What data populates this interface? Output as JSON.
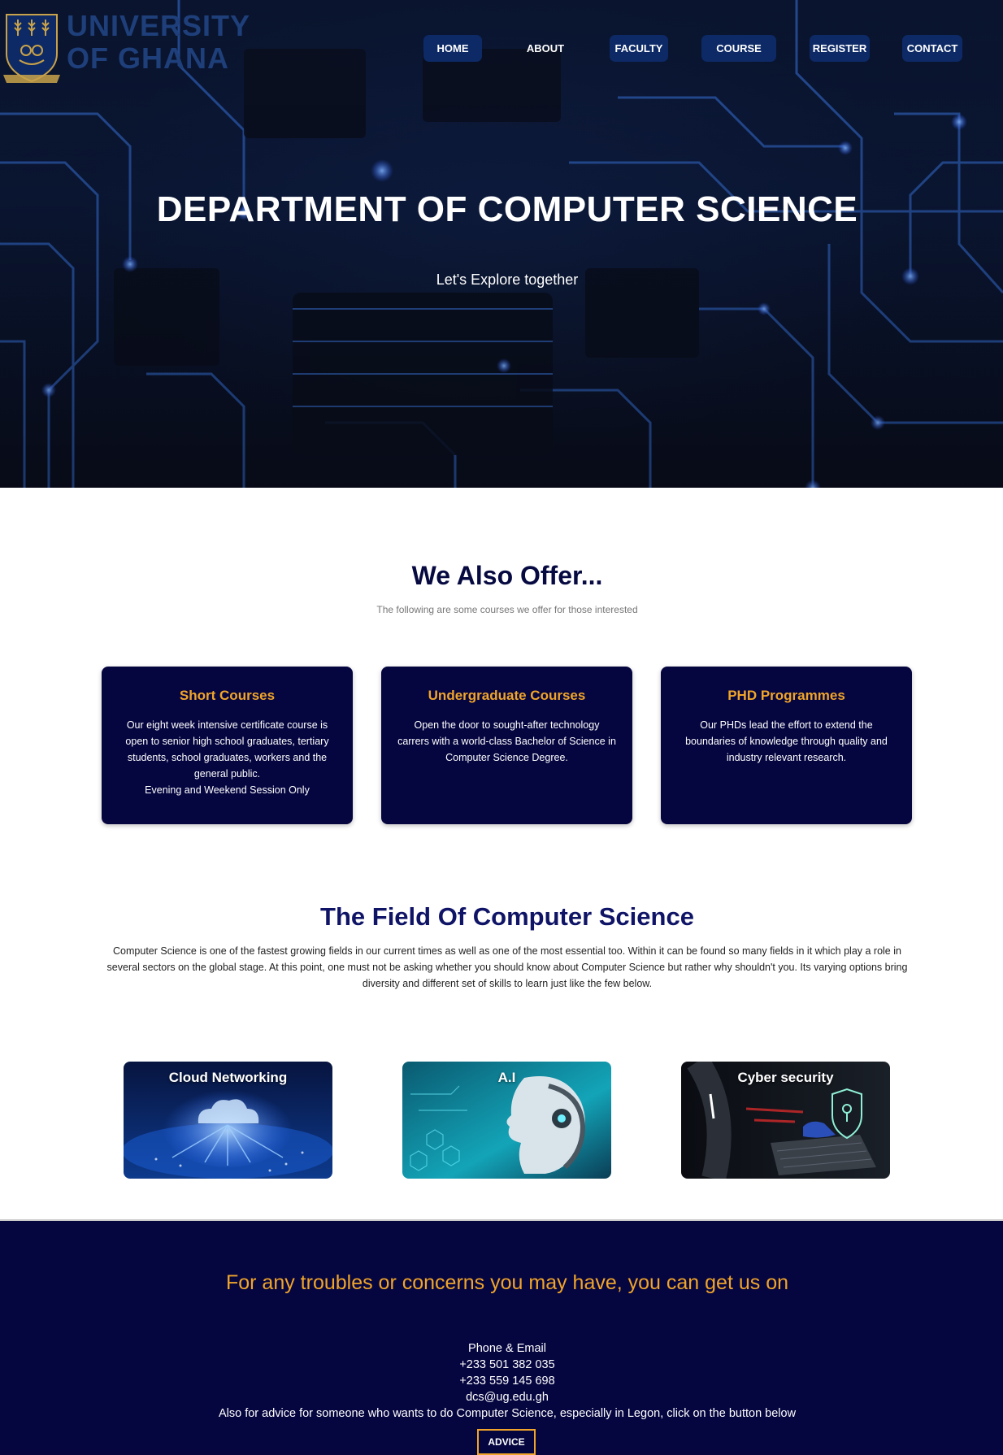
{
  "header": {
    "logo_text_line1": "UNIVERSITY",
    "logo_text_line2": "OF GHANA",
    "nav": [
      {
        "label": "HOME"
      },
      {
        "label": "ABOUT"
      },
      {
        "label": "FACULTY"
      },
      {
        "label": "COURSE"
      },
      {
        "label": "REGISTER"
      },
      {
        "label": "CONTACT"
      }
    ]
  },
  "hero": {
    "title": "DEPARTMENT OF COMPUTER SCIENCE",
    "subtitle": "Let's Explore together"
  },
  "offer": {
    "title": "We Also Offer...",
    "subtitle": "The following are some courses we offer for those interested",
    "cards": [
      {
        "title": "Short Courses",
        "text": "Our eight week intensive certificate course is open to senior high school graduates, tertiary students, school graduates, workers and the general public.",
        "note": "Evening and Weekend Session Only"
      },
      {
        "title": "Undergraduate Courses",
        "text": "Open the door to sought-after technology carrers with a world-class Bachelor of Science in Computer Science Degree."
      },
      {
        "title": "PHD Programmes",
        "text": "Our PHDs lead the effort to extend the boundaries of knowledge through quality and industry relevant research."
      }
    ]
  },
  "field": {
    "title": "The Field Of Computer Science",
    "text": "Computer Science is one of the fastest growing fields in our current times as well as one of the most essential too. Within it can be found so many fields in it which play a role in several sectors on the global stage. At this point, one must not be asking whether you should know about Computer Science but rather why shouldn't you. Its varying options bring diversity and different set of skills to learn just like the few below.",
    "tiles": [
      {
        "label": "Cloud Networking"
      },
      {
        "label": "A.I"
      },
      {
        "label": "Cyber security"
      }
    ]
  },
  "footer": {
    "title": "For any troubles or concerns you may have, you can get us on",
    "contact_heading": "Phone & Email",
    "phone1": "+233 501 382 035",
    "phone2": "+233 559 145 698",
    "email": "dcs@ug.edu.gh",
    "advice_text": "Also for advice for someone who wants to do Computer Science, especially in Legon, click on the button below",
    "advice_button": "ADVICE"
  },
  "colors": {
    "navy": "#050540",
    "accent_orange": "#f0a52a",
    "nav_button": "#0d2a66",
    "heading_blue": "#0f1466"
  }
}
